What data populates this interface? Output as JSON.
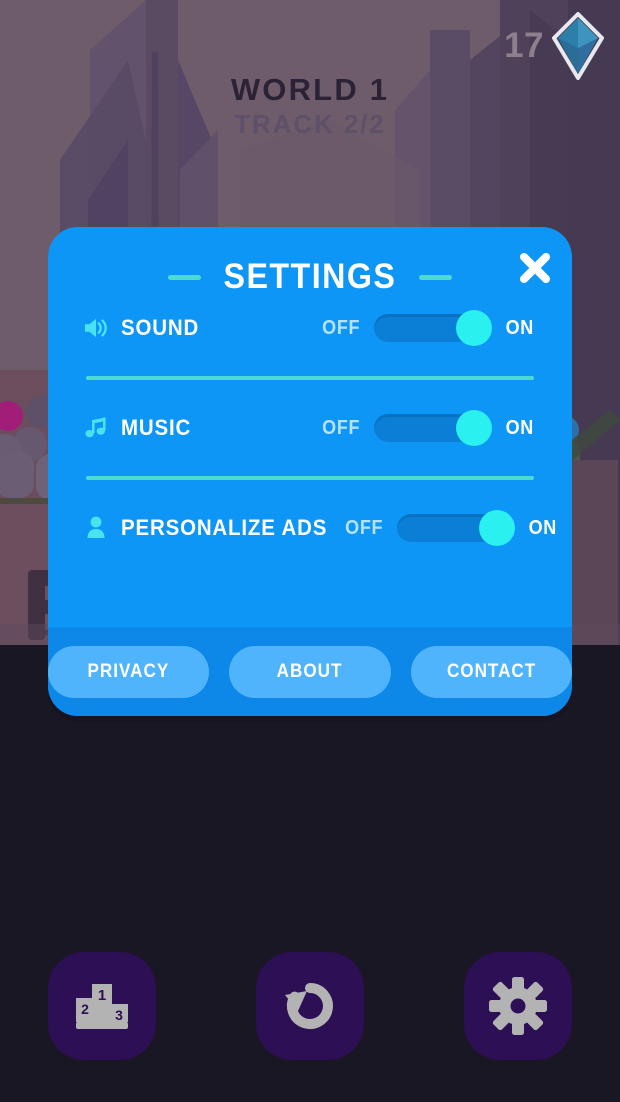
{
  "hud": {
    "world_title": "WORLD 1",
    "track_subtitle": "TRACK 2/2",
    "gem_count": "17",
    "gem_icon": "diamond-gem-icon"
  },
  "dialog": {
    "title": "SETTINGS",
    "close_icon": "close-x-icon",
    "rows": [
      {
        "icon": "speaker-sound-icon",
        "label": "SOUND",
        "off_label": "OFF",
        "on_label": "ON",
        "state": "on"
      },
      {
        "icon": "music-note-icon",
        "label": "MUSIC",
        "off_label": "OFF",
        "on_label": "ON",
        "state": "on"
      },
      {
        "icon": "person-user-icon",
        "label": "PERSONALIZE ADS",
        "off_label": "OFF",
        "on_label": "ON",
        "state": "on"
      }
    ],
    "footer": {
      "privacy_label": "PRIVACY",
      "about_label": "ABOUT",
      "contact_label": "CONTACT"
    }
  },
  "bottom_nav": [
    {
      "icon": "leaderboard-podium-icon",
      "name": "leaderboard-button"
    },
    {
      "icon": "restart-undo-arrow-icon",
      "name": "restart-button"
    },
    {
      "icon": "gear-settings-icon",
      "name": "settings-button"
    }
  ],
  "colors": {
    "dialog_blue": "#0d96f5",
    "dialog_footer_blue": "#0d88e8",
    "toggle_track": "#0b7fd6",
    "toggle_knob_cyan": "#2af0f0",
    "divider_teal": "#4ddbd0",
    "footer_button_blue": "#4fb4fb",
    "scene_background": "#6d5a6a",
    "dark_bottom": "#1a1724",
    "nav_button_purple": "#2d0f55",
    "nav_icon_gray": "#b3b3b3",
    "world_text": "#2b2235",
    "track_text": "#5d5068",
    "gem_count_text": "#8d7f8c"
  }
}
